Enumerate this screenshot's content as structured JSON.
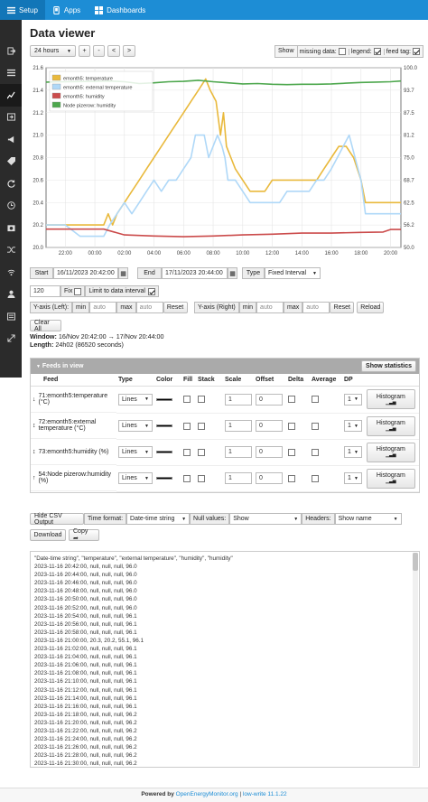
{
  "topbar": {
    "items": [
      {
        "label": "Setup",
        "icon": "menu-icon"
      },
      {
        "label": "Apps",
        "icon": "apps-icon"
      },
      {
        "label": "Dashboards",
        "icon": "dashboard-icon"
      }
    ]
  },
  "sidebar": {
    "items": [
      "logout-icon",
      "list-icon",
      "graph-icon",
      "input-icon",
      "megaphone-icon",
      "tag-icon",
      "sync-icon",
      "clock-icon",
      "backup-icon",
      "shuffle-icon",
      "wifi-icon",
      "user-icon",
      "admin-icon",
      "expand-icon"
    ]
  },
  "page": {
    "title": "Data viewer"
  },
  "toolbar": {
    "zoom": "24 hours",
    "zoom_in": "+",
    "zoom_out": "-",
    "pan_left": "<",
    "pan_right": ">",
    "show_label": "Show",
    "missing_data_label": "missing data:",
    "legend_label": "legend:",
    "feed_tag_label": "feed tag:"
  },
  "chart_data": {
    "type": "line",
    "x_ticks": [
      "22:00",
      "00:00",
      "02:00",
      "04:00",
      "06:00",
      "08:00",
      "10:00",
      "12:00",
      "14:00",
      "16:00",
      "18:00",
      "20:00"
    ],
    "y_left_ticks": [
      "20.0",
      "20.2",
      "20.4",
      "20.6",
      "20.8",
      "21.0",
      "21.2",
      "21.4",
      "21.6"
    ],
    "y_right_ticks": [
      "50.0",
      "56.2",
      "62.5",
      "68.7",
      "75.0",
      "81.2",
      "87.5",
      "93.7",
      "100.0"
    ],
    "ylim_left": [
      20.0,
      21.6
    ],
    "ylim_right": [
      50.0,
      100.0
    ],
    "x_range_hours": [
      20.7,
      44.7
    ],
    "legend": "top-left",
    "grid": true,
    "series": [
      {
        "name": "emonth5: temperature",
        "axis": "left",
        "color": "#e9b93c",
        "points": [
          [
            20.7,
            20.2
          ],
          [
            21.5,
            20.2
          ],
          [
            22.0,
            20.2
          ],
          [
            22.5,
            20.2
          ],
          [
            23.0,
            20.2
          ],
          [
            23.5,
            20.2
          ],
          [
            24.0,
            20.2
          ],
          [
            24.6,
            20.2
          ],
          [
            24.9,
            20.3
          ],
          [
            25.2,
            20.2
          ],
          [
            25.5,
            20.3
          ],
          [
            26.0,
            20.4
          ],
          [
            26.5,
            20.5
          ],
          [
            27.0,
            20.6
          ],
          [
            27.5,
            20.7
          ],
          [
            28.0,
            20.8
          ],
          [
            28.5,
            20.9
          ],
          [
            29.0,
            21.0
          ],
          [
            29.5,
            21.1
          ],
          [
            30.0,
            21.2
          ],
          [
            30.5,
            21.3
          ],
          [
            31.0,
            21.4
          ],
          [
            31.5,
            21.5
          ],
          [
            31.8,
            21.4
          ],
          [
            32.2,
            21.3
          ],
          [
            32.5,
            21.0
          ],
          [
            32.7,
            21.2
          ],
          [
            32.9,
            20.9
          ],
          [
            33.2,
            20.8
          ],
          [
            33.5,
            20.7
          ],
          [
            34.0,
            20.6
          ],
          [
            34.5,
            20.5
          ],
          [
            35.0,
            20.5
          ],
          [
            35.5,
            20.5
          ],
          [
            36.0,
            20.6
          ],
          [
            36.5,
            20.6
          ],
          [
            37.0,
            20.6
          ],
          [
            37.5,
            20.6
          ],
          [
            38.0,
            20.6
          ],
          [
            38.5,
            20.6
          ],
          [
            39.0,
            20.6
          ],
          [
            39.5,
            20.7
          ],
          [
            40.0,
            20.8
          ],
          [
            40.5,
            20.9
          ],
          [
            41.0,
            20.9
          ],
          [
            41.5,
            20.8
          ],
          [
            42.0,
            20.6
          ],
          [
            42.3,
            20.4
          ],
          [
            43.0,
            20.4
          ],
          [
            43.5,
            20.4
          ],
          [
            44.0,
            20.4
          ],
          [
            44.7,
            20.4
          ]
        ]
      },
      {
        "name": "emonth5: external temperature",
        "axis": "left",
        "color": "#afd8f8",
        "points": [
          [
            20.7,
            20.2
          ],
          [
            21.5,
            20.2
          ],
          [
            22.0,
            20.2
          ],
          [
            23.0,
            20.1
          ],
          [
            24.0,
            20.1
          ],
          [
            24.6,
            20.1
          ],
          [
            25.0,
            20.2
          ],
          [
            25.5,
            20.3
          ],
          [
            26.0,
            20.4
          ],
          [
            26.5,
            20.3
          ],
          [
            27.0,
            20.4
          ],
          [
            27.5,
            20.5
          ],
          [
            28.0,
            20.6
          ],
          [
            28.5,
            20.5
          ],
          [
            29.0,
            20.6
          ],
          [
            29.5,
            20.6
          ],
          [
            30.0,
            20.7
          ],
          [
            30.5,
            20.8
          ],
          [
            30.8,
            21.0
          ],
          [
            31.4,
            21.0
          ],
          [
            31.7,
            20.8
          ],
          [
            32.0,
            20.9
          ],
          [
            32.3,
            21.0
          ],
          [
            32.6,
            20.9
          ],
          [
            32.8,
            20.8
          ],
          [
            33.0,
            20.6
          ],
          [
            33.5,
            20.6
          ],
          [
            34.0,
            20.5
          ],
          [
            34.5,
            20.4
          ],
          [
            35.0,
            20.4
          ],
          [
            35.5,
            20.4
          ],
          [
            36.0,
            20.4
          ],
          [
            36.5,
            20.4
          ],
          [
            37.0,
            20.5
          ],
          [
            37.5,
            20.5
          ],
          [
            38.0,
            20.5
          ],
          [
            38.5,
            20.5
          ],
          [
            39.0,
            20.6
          ],
          [
            39.5,
            20.6
          ],
          [
            40.0,
            20.7
          ],
          [
            40.4,
            20.8
          ],
          [
            40.8,
            20.9
          ],
          [
            41.2,
            21.0
          ],
          [
            41.6,
            20.8
          ],
          [
            42.0,
            20.6
          ],
          [
            42.3,
            20.3
          ],
          [
            43.0,
            20.3
          ],
          [
            44.0,
            20.3
          ],
          [
            44.7,
            20.3
          ]
        ]
      },
      {
        "name": "emonth5: humidity",
        "axis": "right",
        "color": "#cb4b4b",
        "points": [
          [
            20.7,
            55.1
          ],
          [
            22.0,
            55.1
          ],
          [
            24.0,
            55.1
          ],
          [
            24.6,
            55.1
          ],
          [
            26.0,
            53.5
          ],
          [
            28.0,
            53.2
          ],
          [
            30.0,
            53.0
          ],
          [
            32.0,
            53.2
          ],
          [
            34.0,
            53.5
          ],
          [
            36.0,
            53.7
          ],
          [
            38.0,
            54.0
          ],
          [
            40.0,
            54.0
          ],
          [
            42.0,
            54.2
          ],
          [
            43.5,
            54.3
          ],
          [
            44.0,
            55.0
          ],
          [
            44.7,
            55.0
          ]
        ]
      },
      {
        "name": "Node pizerow: humidity",
        "axis": "right",
        "color": "#4da74d",
        "points": [
          [
            20.7,
            96.0
          ],
          [
            22.0,
            96.1
          ],
          [
            24.0,
            96.2
          ],
          [
            25.0,
            96.3
          ],
          [
            26.0,
            96.1
          ],
          [
            27.0,
            95.6
          ],
          [
            28.0,
            95.8
          ],
          [
            29.0,
            96.1
          ],
          [
            30.0,
            96.2
          ],
          [
            31.0,
            96.5
          ],
          [
            32.0,
            96.1
          ],
          [
            33.0,
            95.8
          ],
          [
            34.0,
            95.5
          ],
          [
            35.0,
            95.6
          ],
          [
            36.0,
            95.4
          ],
          [
            37.0,
            95.3
          ],
          [
            38.0,
            95.4
          ],
          [
            39.0,
            95.4
          ],
          [
            40.0,
            95.5
          ],
          [
            41.0,
            95.7
          ],
          [
            42.0,
            95.9
          ],
          [
            43.0,
            96.0
          ],
          [
            44.0,
            96.1
          ],
          [
            44.7,
            96.3
          ]
        ]
      }
    ]
  },
  "range": {
    "start_label": "Start",
    "start_value": "16/11/2023 20:42:00",
    "end_label": "End",
    "end_value": "17/11/2023 20:44:00",
    "type_label": "Type",
    "type_value": "Fixed Interval",
    "interval_value": "120",
    "fix_label": "Fix",
    "limit_label": "Limit to data interval"
  },
  "yaxis": {
    "left_label": "Y-axis (Left):",
    "right_label": "Y-axis (Right)",
    "min_label": "min",
    "max_label": "max",
    "auto": "auto",
    "reset_label": "Reset",
    "reload_label": "Reload",
    "clear_all_label": "Clear All"
  },
  "window_info": {
    "window_label": "Window:",
    "window_value": "16/Nov 20:42:00 → 17/Nov 20:44:00",
    "length_label": "Length:",
    "length_value": "24h02 (86520 seconds)"
  },
  "feeds_panel": {
    "title": "Feeds in view",
    "show_stats_label": "Show statistics",
    "columns": [
      "Feed",
      "Type",
      "Color",
      "Fill",
      "Stack",
      "Scale",
      "Offset",
      "Delta",
      "Average",
      "DP"
    ],
    "rows": [
      {
        "feed": "71:emonth5:temperature (°C)",
        "type": "Lines",
        "scale": "1",
        "offset": "0",
        "dp": "1"
      },
      {
        "feed": "72:emonth5:external temperature (°C)",
        "type": "Lines",
        "scale": "1",
        "offset": "0",
        "dp": "1"
      },
      {
        "feed": "73:emonth5:humidity (%)",
        "type": "Lines",
        "scale": "1",
        "offset": "0",
        "dp": "1"
      },
      {
        "feed": "54:Node pizerow:humidity (%)",
        "type": "Lines",
        "scale": "1",
        "offset": "0",
        "dp": "1"
      }
    ],
    "histogram_label": "Histogram"
  },
  "csv": {
    "hide_label": "Hide CSV Output",
    "time_format_label": "Time format:",
    "time_format_value": "Date-time string",
    "null_values_label": "Null values:",
    "null_values_value": "Show",
    "headers_label": "Headers:",
    "headers_value": "Show name",
    "download_label": "Download",
    "copy_label": "Copy ➦",
    "lines": [
      "\"Date-time string\", \"temperature\", \"external temperature\", \"humidity\", \"humidity\"",
      "2023-11-16 20:42:00, null, null, null, 96.0",
      "2023-11-16 20:44:00, null, null, null, 96.0",
      "2023-11-16 20:46:00, null, null, null, 96.0",
      "2023-11-16 20:48:00, null, null, null, 96.0",
      "2023-11-16 20:50:00, null, null, null, 96.0",
      "2023-11-16 20:52:00, null, null, null, 96.0",
      "2023-11-16 20:54:00, null, null, null, 96.1",
      "2023-11-16 20:56:00, null, null, null, 96.1",
      "2023-11-16 20:58:00, null, null, null, 96.1",
      "2023-11-16 21:00:00, 20.3, 20.2, 55.1, 96.1",
      "2023-11-16 21:02:00, null, null, null, 96.1",
      "2023-11-16 21:04:00, null, null, null, 96.1",
      "2023-11-16 21:06:00, null, null, null, 96.1",
      "2023-11-16 21:08:00, null, null, null, 96.1",
      "2023-11-16 21:10:00, null, null, null, 96.1",
      "2023-11-16 21:12:00, null, null, null, 96.1",
      "2023-11-16 21:14:00, null, null, null, 96.1",
      "2023-11-16 21:16:00, null, null, null, 96.1",
      "2023-11-16 21:18:00, null, null, null, 96.2",
      "2023-11-16 21:20:00, null, null, null, 96.2",
      "2023-11-16 21:22:00, null, null, null, 96.2",
      "2023-11-16 21:24:00, null, null, null, 96.2",
      "2023-11-16 21:26:00, null, null, null, 96.2",
      "2023-11-16 21:28:00, null, null, null, 96.2",
      "2023-11-16 21:30:00, null, null, null, 96.2",
      "2023-11-16 21:32:00, null, null, null, 96.2"
    ]
  },
  "footer": {
    "prefix": "Powered by",
    "link": "OpenEnergyMonitor.org",
    "separator": "|",
    "version": "low-write 11.1.22"
  }
}
